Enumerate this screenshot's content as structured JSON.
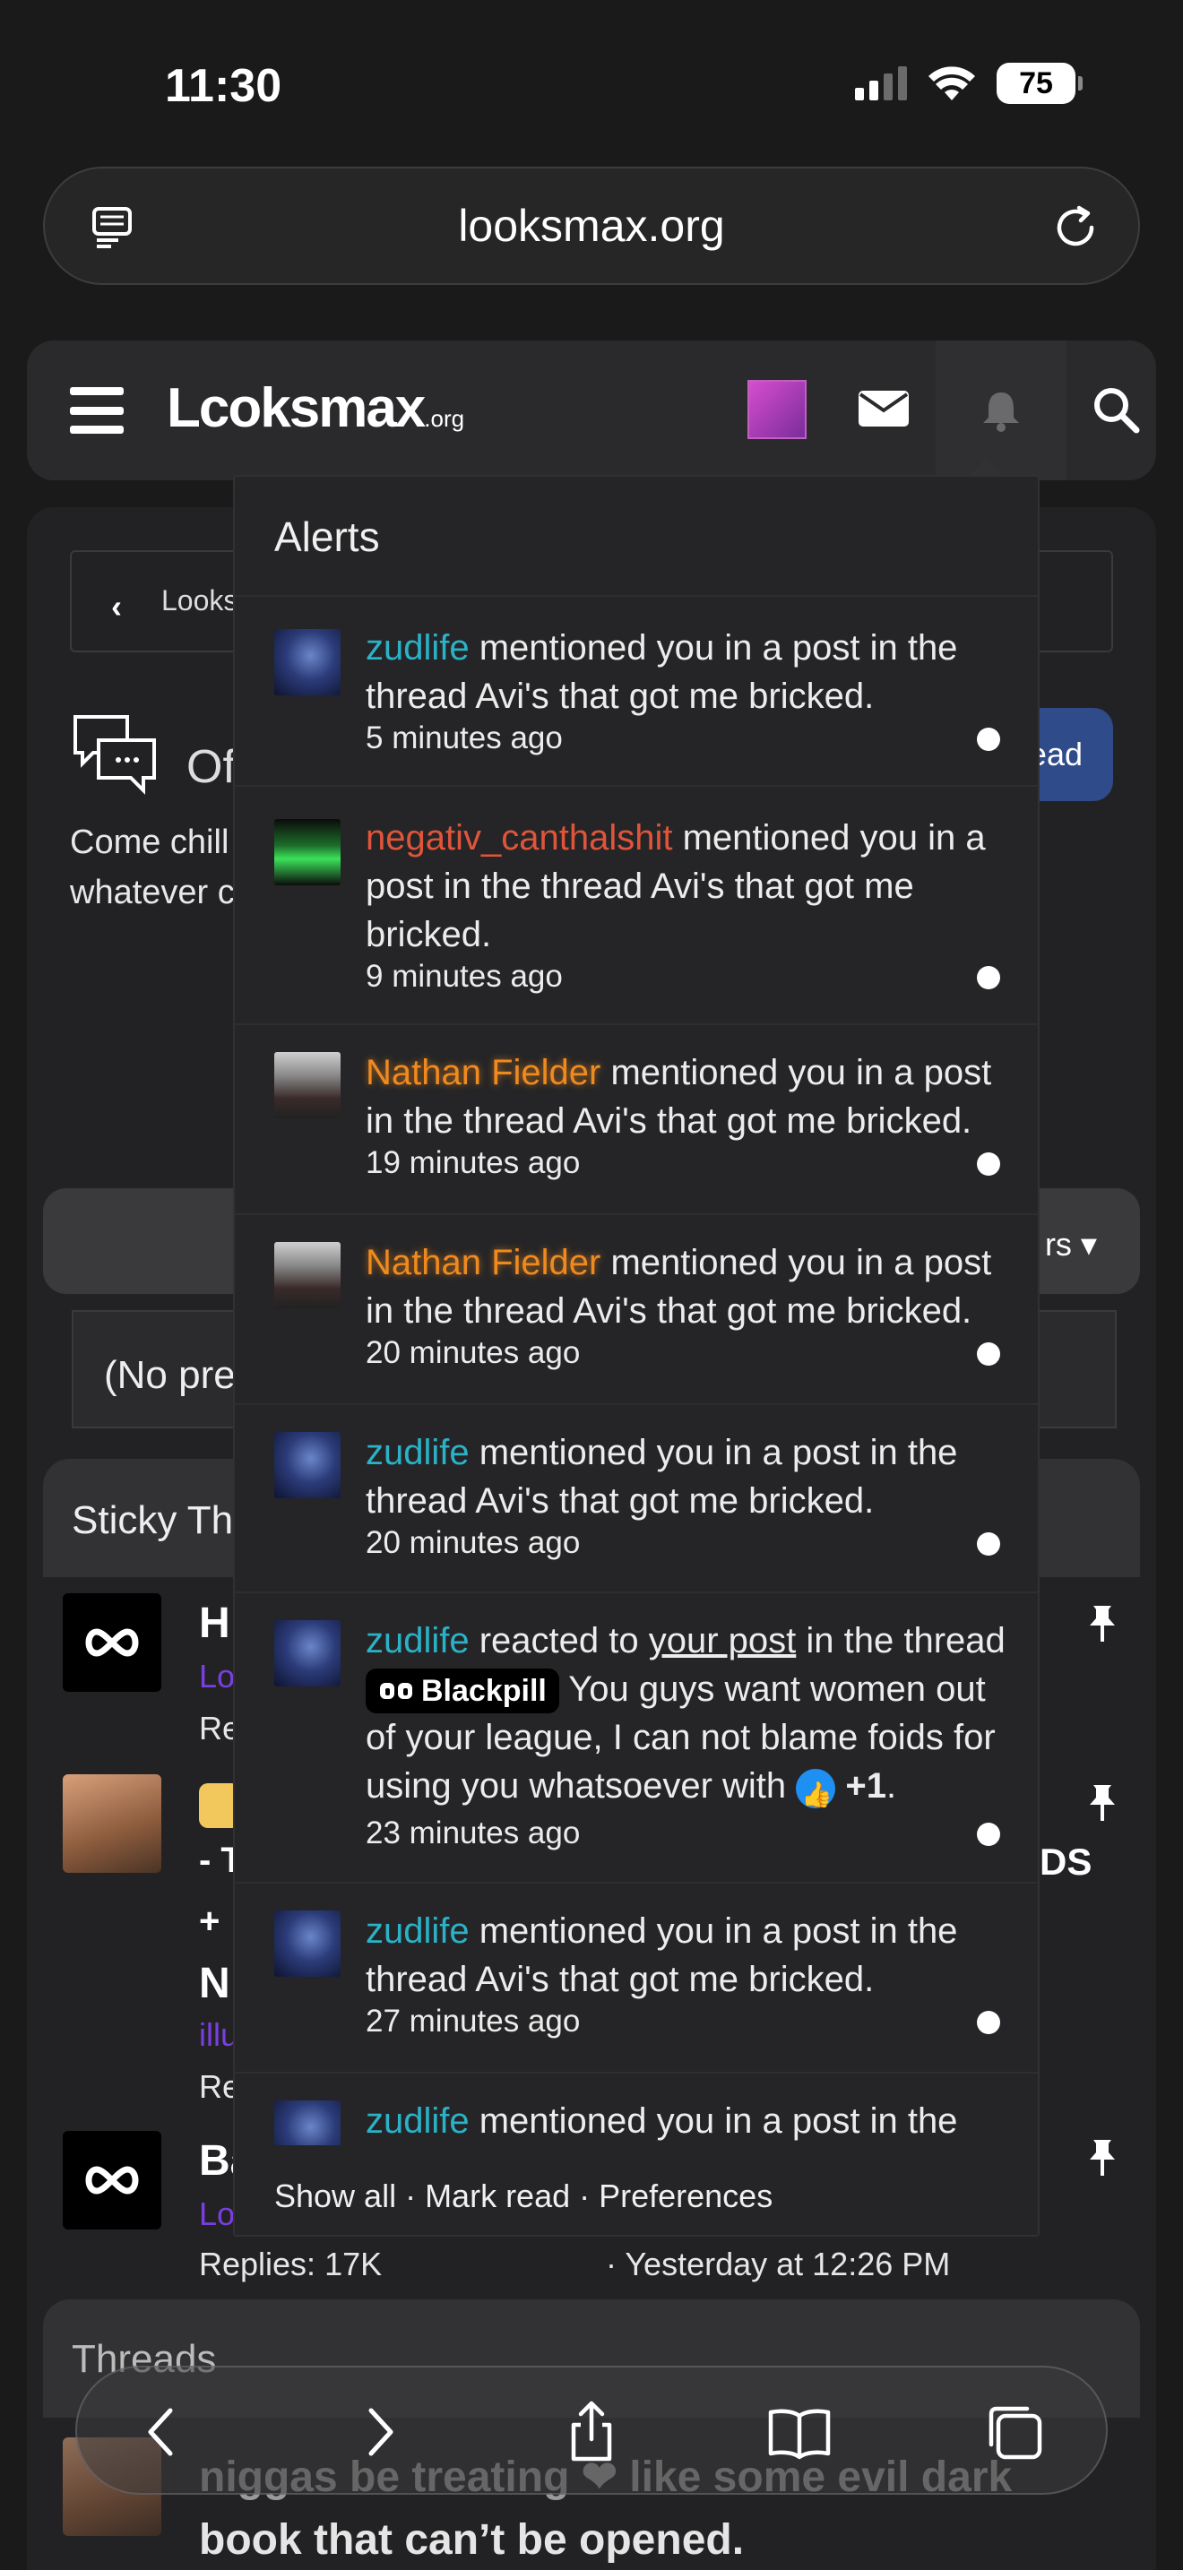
{
  "status_bar": {
    "time": "11:30",
    "battery": "75"
  },
  "browser": {
    "url": "looksmax.org"
  },
  "site": {
    "logo": "Lcoksmax",
    "logo_suffix": ".org"
  },
  "background": {
    "breadcrumb": "Looks",
    "forum_title": "Of",
    "forum_desc": "Come chill whatever c",
    "new_thread_btn": "ead",
    "filters_label": "rs ▾",
    "no_prefix": "(No pre",
    "sticky_heading": "Sticky Th",
    "threads_heading": "Threads",
    "t1_title": "H",
    "t1_sub": "Lo",
    "t1_meta": "Re",
    "t2_title_a": "- T",
    "t2_title_b": "+",
    "t2_title_c": "N",
    "t2_right": "DS",
    "t2_sub": "illu",
    "t2_meta": "Re",
    "t3_title": "Ba",
    "t3_sub": "Lo",
    "t3_replies": "Replies: 17K",
    "t3_last": "· Yesterday at 12:26 PM",
    "bottom_thread_a": "niggas be treating  ❤ like some evil dark",
    "bottom_thread_b": "book that can’t be opened."
  },
  "alerts": {
    "title": "Alerts",
    "items": [
      {
        "user": "zudlife",
        "text": " mentioned you in a post in the thread Avi's that got me bricked.",
        "time": "5 minutes ago"
      },
      {
        "user": "negativ_canthalshit",
        "text": " mentioned you in a post in the thread Avi's that got me bricked.",
        "time": "9 minutes ago"
      },
      {
        "user": "Nathan Fielder",
        "text": " mentioned you in a post in the thread Avi's that got me bricked.",
        "time": "19 minutes ago"
      },
      {
        "user": "Nathan Fielder",
        "text": " mentioned you in a post in the thread Avi's that got me bricked.",
        "time": "20 minutes ago"
      },
      {
        "user": "zudlife",
        "text": " mentioned you in a post in the thread Avi's that got me bricked.",
        "time": "20 minutes ago"
      },
      {
        "user": "zudlife",
        "text_a": " reacted to ",
        "link": "your post",
        "text_b": " in the thread ",
        "prefix": "Blackpill",
        "text_c": " You guys want women out of your league, I can not blame foids for using you whatsoever with ",
        "reaction": "+1",
        "text_d": ".",
        "time": "23 minutes ago"
      },
      {
        "user": "zudlife",
        "text": " mentioned you in a post in the thread Avi's that got me bricked.",
        "time": "27 minutes ago"
      },
      {
        "user": "zudlife",
        "text": " mentioned you in a post in the"
      }
    ],
    "footer": "Show all · Mark read · Preferences"
  }
}
